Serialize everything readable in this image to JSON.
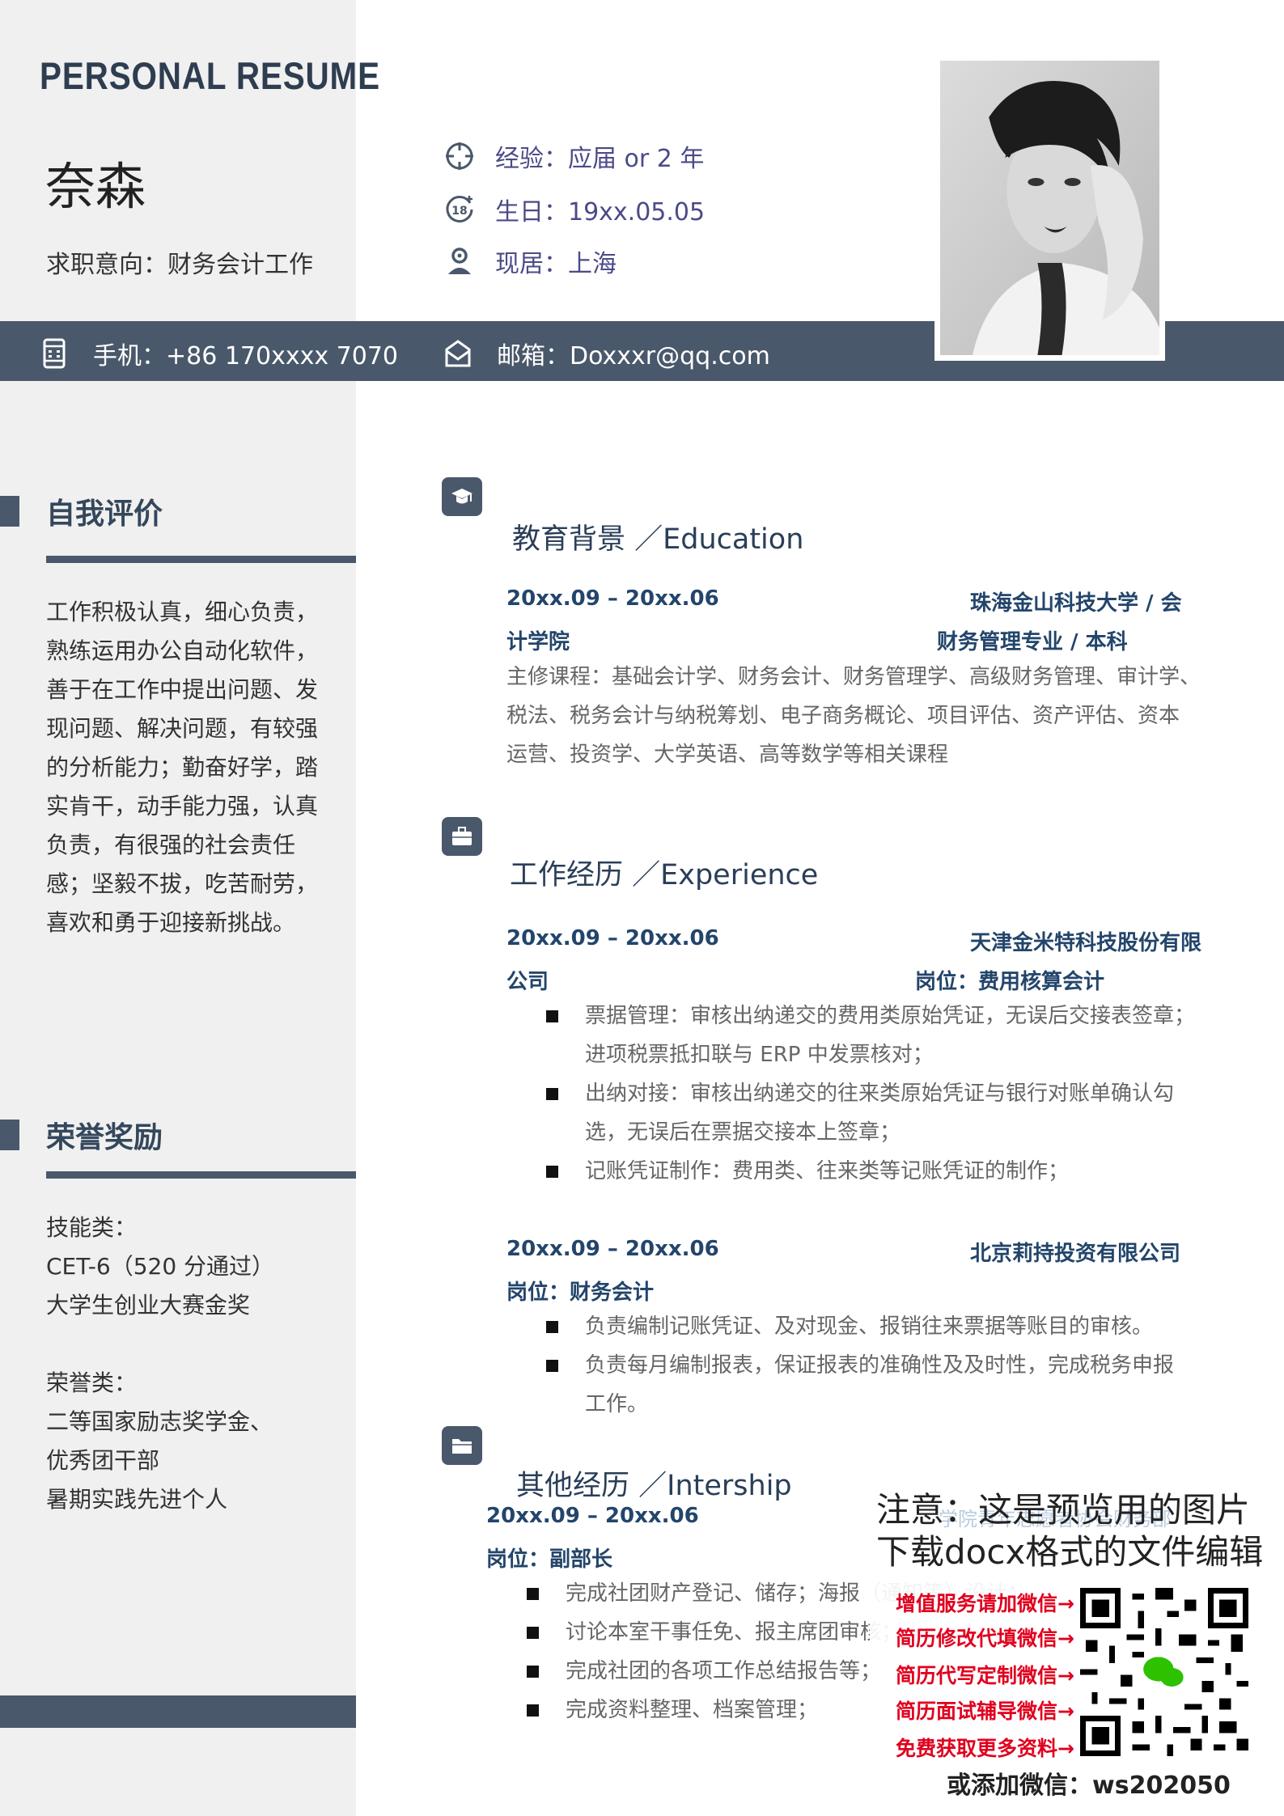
{
  "header": {
    "title": "PERSONAL RESUME",
    "name": "奈森",
    "intent": "求职意向：财务会计工作"
  },
  "info": {
    "experience": "经验：应届 or 2 年",
    "birthday": "生日：19xx.05.05",
    "residence": "现居：上海"
  },
  "contact": {
    "phone": "手机：+86 170xxxx 7070",
    "email": "邮箱：Doxxxr@qq.com"
  },
  "sidebar": {
    "self_eval": {
      "heading": "自我评价",
      "lines": [
        "工作积极认真，细心负责，",
        "熟练运用办公自动化软件，",
        "善于在工作中提出问题、发",
        "现问题、解决问题，有较强",
        "的分析能力；勤奋好学，踏",
        "实肯干，动手能力强，认真",
        "负责，有很强的社会责任",
        "感；坚毅不拔，吃苦耐劳，",
        "喜欢和勇于迎接新挑战。"
      ]
    },
    "honors": {
      "heading": "荣誉奖励",
      "lines": [
        "技能类：",
        "CET-6（520 分通过）",
        "大学生创业大赛金奖",
        "",
        "荣誉类：",
        "二等国家励志奖学金、",
        "优秀团干部",
        "暑期实践先进个人"
      ]
    }
  },
  "education": {
    "title": "教育背景 ／Education",
    "date": "20xx.09 – 20xx.06",
    "school_part1": "珠海金山科技大学 / 会",
    "school_part2": "计学院",
    "major": "财务管理专业 / 本科",
    "courses": [
      "主修课程：基础会计学、财务会计、财务管理学、高级财务管理、审计学、",
      "税法、税务会计与纳税筹划、电子商务概论、项目评估、资产评估、资本",
      "运营、投资学、大学英语、高等数学等相关课程"
    ]
  },
  "experience": {
    "title": "工作经历 ／Experience",
    "jobs": [
      {
        "date": "20xx.09 – 20xx.06",
        "company_part1": "天津金米特科技股份有限",
        "company_part2": "公司",
        "position": "岗位：费用核算会计",
        "bullets": [
          [
            "票据管理：审核出纳递交的费用类原始凭证，无误后交接表签章；",
            "进项税票抵扣联与 ERP 中发票核对；"
          ],
          [
            "出纳对接：审核出纳递交的往来类原始凭证与银行对账单确认勾",
            "选，无误后在票据交接本上签章；"
          ],
          [
            "记账凭证制作：费用类、往来类等记账凭证的制作；"
          ]
        ]
      },
      {
        "date": "20xx.09 – 20xx.06",
        "company": "北京莉持投资有限公司",
        "position": "岗位：财务会计",
        "bullets": [
          [
            "负责编制记账凭证、及对现金、报销往来票据等账目的审核。"
          ],
          [
            "负责每月编制报表，保证报表的准确性及及时性，完成税务申报",
            "工作。"
          ]
        ]
      }
    ]
  },
  "other": {
    "title": "其他经历 ／Intership",
    "date": "20xx.09 – 20xx.06",
    "org": "学院青年志愿者协会财务部",
    "position": "岗位：副部长",
    "bullets": [
      "完成社团财产登记、储存；海报（通知等）设计；",
      "讨论本室干事任免、报主席团审核；",
      "完成社团的各项工作总结报告等；",
      "完成资料整理、档案管理；"
    ]
  },
  "watermark": {
    "line1": "注意：这是预览用的图片",
    "line2": "下载docx格式的文件编辑",
    "links": [
      "增值服务请加微信→",
      "简历修改代填微信→",
      "简历代写定制微信→",
      "简历面试辅导微信→",
      "免费获取更多资料→"
    ],
    "footer": "或添加微信：ws202050",
    "accent": "#e0001e"
  },
  "colors": {
    "band": "#4a586b",
    "sidebar_bg": "#f0f0f0",
    "heading": "#2a3e58",
    "meta": "#23456b",
    "info": "#4b4a88"
  }
}
